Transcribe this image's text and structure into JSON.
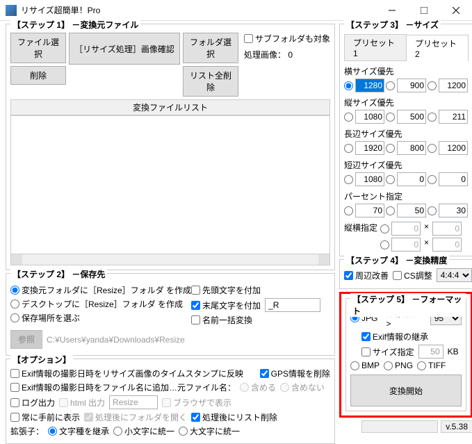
{
  "window": {
    "title": "リサイズ超簡単！Pro"
  },
  "step1": {
    "title": "【ステップ 1】 －変換元ファイル",
    "file_select": "ファイル選択",
    "delete": "削除",
    "resize_confirm": "［リサイズ処理］画像確認",
    "folder_select": "フォルダ選択",
    "list_delete_all": "リスト全削除",
    "subfolder": "サブフォルダも対象",
    "process_images": "処理画像： 0",
    "list_header": "変換ファイルリスト"
  },
  "step2": {
    "title": "【ステップ 2】 －保存先",
    "opt1": "変換元フォルダに［Resize］フォルダ を作成",
    "opt2": "デスクトップに［Resize］フォルダ を作成",
    "opt3": "保存場所を選ぶ",
    "prefix": "先頭文字を付加",
    "suffix": "末尾文字を付加",
    "suffix_val": "_R",
    "rename_all": "名前一括変換",
    "browse": "参照",
    "path": "C:¥Users¥yanda¥Downloads¥Resize"
  },
  "options": {
    "title": "【オプション】",
    "exif_timestamp": "Exif情報の撮影日時をリサイズ画像のタイムスタンプに反映",
    "gps_delete": "GPS情報を削除",
    "exif_filename": "Exif情報の撮影日時をファイル名に追加…元ファイル名：",
    "include": "含める",
    "exclude": "含めない",
    "log_output": "ログ出力",
    "html_output": "html 出力",
    "html_val": "Resize",
    "browser_show": "ブラウザで表示",
    "always_front": "常に手前に表示",
    "open_folder": "処理後にフォルダを開く",
    "delete_list": "処理後にリスト削除",
    "ext_label": "拡張子：",
    "ext_inherit": "文字種を継承",
    "ext_lower": "小文字に統一",
    "ext_upper": "大文字に統一"
  },
  "step3": {
    "title": "【ステップ 3】 －サイズ",
    "tab1": "プリセット 1",
    "tab2": "プリセット 2",
    "width_priority": "横サイズ優先",
    "width_vals": [
      "1280",
      "900",
      "1200"
    ],
    "height_priority": "縦サイズ優先",
    "height_vals": [
      "1080",
      "500",
      "211"
    ],
    "long_priority": "長辺サイズ優先",
    "long_vals": [
      "1920",
      "800",
      "1200"
    ],
    "short_priority": "短辺サイズ優先",
    "short_vals": [
      "1080",
      "0",
      "0"
    ],
    "percent": "パーセント指定",
    "percent_vals": [
      "70",
      "50",
      "30"
    ],
    "wh": "縦横指定",
    "wh_w1": "0",
    "wh_h1": "0",
    "wh_w2": "0",
    "wh_h2": "0"
  },
  "step4": {
    "title": "【ステップ 4】 －変換精度",
    "edge": "周辺改善",
    "cs": "CS調整",
    "cs_val": "4:4:4"
  },
  "step5": {
    "title": "【ステップ 5】 －フォーマット",
    "jpg": "JPG",
    "quality_lbl": "保存品質 >",
    "quality_val": "95",
    "exif_inherit": "Exif情報の継承",
    "size_spec": "サイズ指定",
    "size_val": "50",
    "kb": "KB",
    "bmp": "BMP",
    "png": "PNG",
    "tiff": "TIFF",
    "start": "変換開始"
  },
  "version": "v.5.38"
}
